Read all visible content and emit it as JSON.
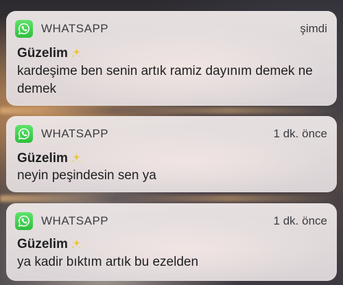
{
  "colors": {
    "whatsapp_icon": "#3ac94a",
    "card_bg": "#e8e2e3",
    "text_primary": "#1f1f22",
    "text_secondary": "#3b3b3f",
    "sparkle": "#e9c33a"
  },
  "notifications": [
    {
      "app_icon": "whatsapp-icon",
      "app_name": "WHATSAPP",
      "time": "şimdi",
      "sender": "Güzelim",
      "sender_emoji": "sparkles-icon",
      "message": "kardeşime ben senin artık ramiz dayınım demek ne demek"
    },
    {
      "app_icon": "whatsapp-icon",
      "app_name": "WHATSAPP",
      "time": "1 dk. önce",
      "sender": "Güzelim",
      "sender_emoji": "sparkles-icon",
      "message": "neyin peşindesin sen ya"
    },
    {
      "app_icon": "whatsapp-icon",
      "app_name": "WHATSAPP",
      "time": "1 dk. önce",
      "sender": "Güzelim",
      "sender_emoji": "sparkles-icon",
      "message": "ya kadir bıktım artık bu ezelden"
    }
  ]
}
